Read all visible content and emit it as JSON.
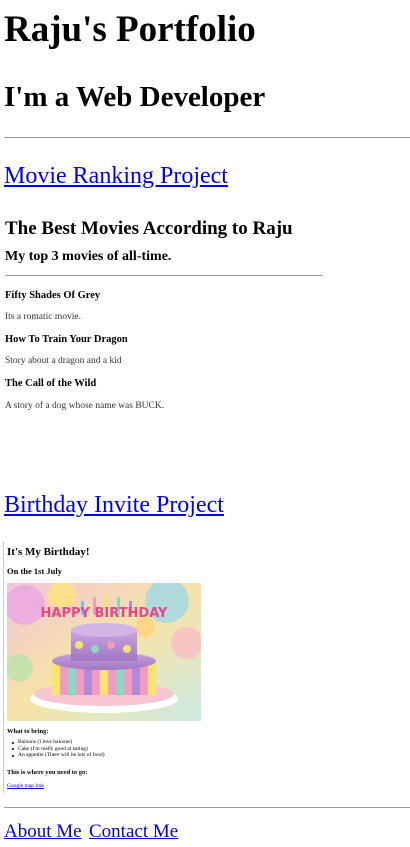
{
  "header": {
    "title": "Raju's Portfolio",
    "subtitle": "I'm a Web Developer"
  },
  "projects": [
    {
      "label": "Movie Ranking Project"
    },
    {
      "label": "Birthday Invite Project"
    }
  ],
  "movie_ranking": {
    "heading": "The Best Movies According to Raju",
    "subheading": "My top 3 movies of all-time.",
    "movies": [
      {
        "title": "Fifty Shades Of Grey",
        "description": "Its a romatic movie."
      },
      {
        "title": "How To Train Your Dragon",
        "description": "Story about a dragon and a kid"
      },
      {
        "title": "The Call of the Wild",
        "description": "A story of a dog whose name was BUCK."
      }
    ]
  },
  "birthday_invite": {
    "heading": "It's My Birthday!",
    "date": "On the 1st July",
    "image": "birthday-cake-image",
    "cake_text": "HAPPY BIRTHDAY",
    "bring_heading": "What to bring:",
    "bring_items": [
      "Baloons (I love baloons)",
      "Cake (I'm really good at eating)",
      "An appetite (There will be lots of food)"
    ],
    "location_heading": "This is where you need to go:",
    "map_link": "Google map link"
  },
  "footer": {
    "about_label": "About Me",
    "contact_label": "Contact Me"
  },
  "colors": {
    "link": "#0000ee",
    "rule": "#9a9a9a",
    "text": "#000000"
  }
}
